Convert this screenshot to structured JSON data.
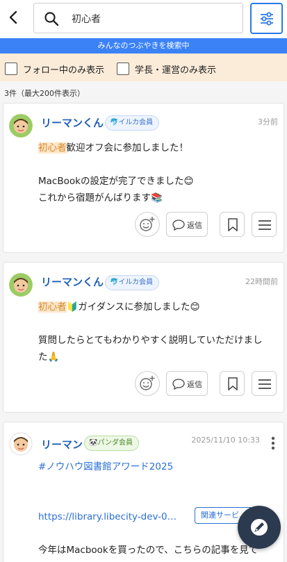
{
  "header": {
    "search_value": "初心者",
    "icons": [
      "back-arrow-icon",
      "search-icon",
      "filter-sliders-icon"
    ]
  },
  "banner": "みんなのつぶやきを検索中",
  "filters": {
    "follow_only": "フォロー中のみ表示",
    "staff_only": "学長・運営のみ表示"
  },
  "result_count": "3件（最大200件表示）",
  "posts": [
    {
      "user": "リーマンくん",
      "badge": "イルカ会員",
      "time": "3分前",
      "highlight": "初心者",
      "line1_rest": "歓迎オフ会に参加しました！",
      "line2": "MacBookの設定が完了できました😊",
      "line3": "これから宿題がんばります📚",
      "reply_label": "返信"
    },
    {
      "user": "リーマンくん",
      "badge": "イルカ会員",
      "time": "22時間前",
      "highlight": "初心者",
      "line1_rest": "🔰ガイダンスに参加しました😊",
      "line2": "質問したらとてもわかりやすく説明していただけまし",
      "line3": "た🙏",
      "reply_label": "返信"
    },
    {
      "user": "リーマン",
      "badge": "パンダ会員",
      "time": "2025/11/10 10:33",
      "hashtag": "#ノウハウ図書館アワード2025",
      "link": "https://library.libecity-dev-0…",
      "related_button": "関連サービ…",
      "line2": "今年はMacbookを買ったので、こちらの記事を見て"
    }
  ],
  "colors": {
    "accent": "#2979e6",
    "banner": "#3b82f6",
    "filter_bar": "#fbecd9",
    "username": "#1f5fb8",
    "highlight_bg": "#fde6c8"
  }
}
